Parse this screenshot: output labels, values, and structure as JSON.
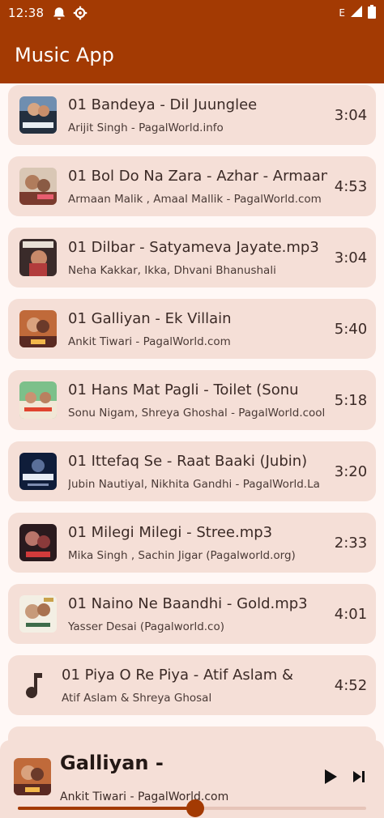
{
  "status_bar": {
    "time": "12:38",
    "network": "E"
  },
  "app_bar": {
    "title": "Music App"
  },
  "songs": [
    {
      "title": "01 Bandeya - Dil Juunglee",
      "artist": "Arijit Singh - PagalWorld.info",
      "duration": "3:04",
      "art": "album-art"
    },
    {
      "title": "01 Bol Do Na Zara - Azhar - Armaan",
      "artist": "Armaan Malik , Amaal Mallik - PagalWorld.com",
      "duration": "4:53",
      "art": "album-art"
    },
    {
      "title": "01 Dilbar - Satyameva Jayate.mp3",
      "artist": "Neha Kakkar, Ikka, Dhvani Bhanushali",
      "duration": "3:04",
      "art": "album-art"
    },
    {
      "title": "01 Galliyan - Ek Villain",
      "artist": "Ankit Tiwari - PagalWorld.com",
      "duration": "5:40",
      "art": "album-art"
    },
    {
      "title": "01 Hans Mat Pagli - Toilet (Sonu",
      "artist": "Sonu Nigam, Shreya Ghoshal - PagalWorld.cool",
      "duration": "5:18",
      "art": "album-art"
    },
    {
      "title": "01 Ittefaq Se - Raat Baaki (Jubin)",
      "artist": "Jubin Nautiyal, Nikhita Gandhi - PagalWorld.La",
      "duration": "3:20",
      "art": "album-art"
    },
    {
      "title": "01 Milegi Milegi - Stree.mp3",
      "artist": "Mika Singh , Sachin Jigar (Pagalworld.org)",
      "duration": "2:33",
      "art": "album-art"
    },
    {
      "title": "01 Naino Ne Baandhi - Gold.mp3",
      "artist": "Yasser Desai (Pagalworld.co)",
      "duration": "4:01",
      "art": "album-art"
    },
    {
      "title": "01 Piya O Re Piya - Atif Aslam &",
      "artist": "Atif Aslam & Shreya Ghosal",
      "duration": "4:52",
      "art": "music-note-icon"
    }
  ],
  "now_playing": {
    "title": "Galliyan -",
    "artist": "Ankit Tiwari - PagalWorld.com",
    "progress_fraction": 0.51
  },
  "colors": {
    "primary": "#a33a03",
    "card": "#f5dfd7",
    "background": "#fff8f6"
  }
}
